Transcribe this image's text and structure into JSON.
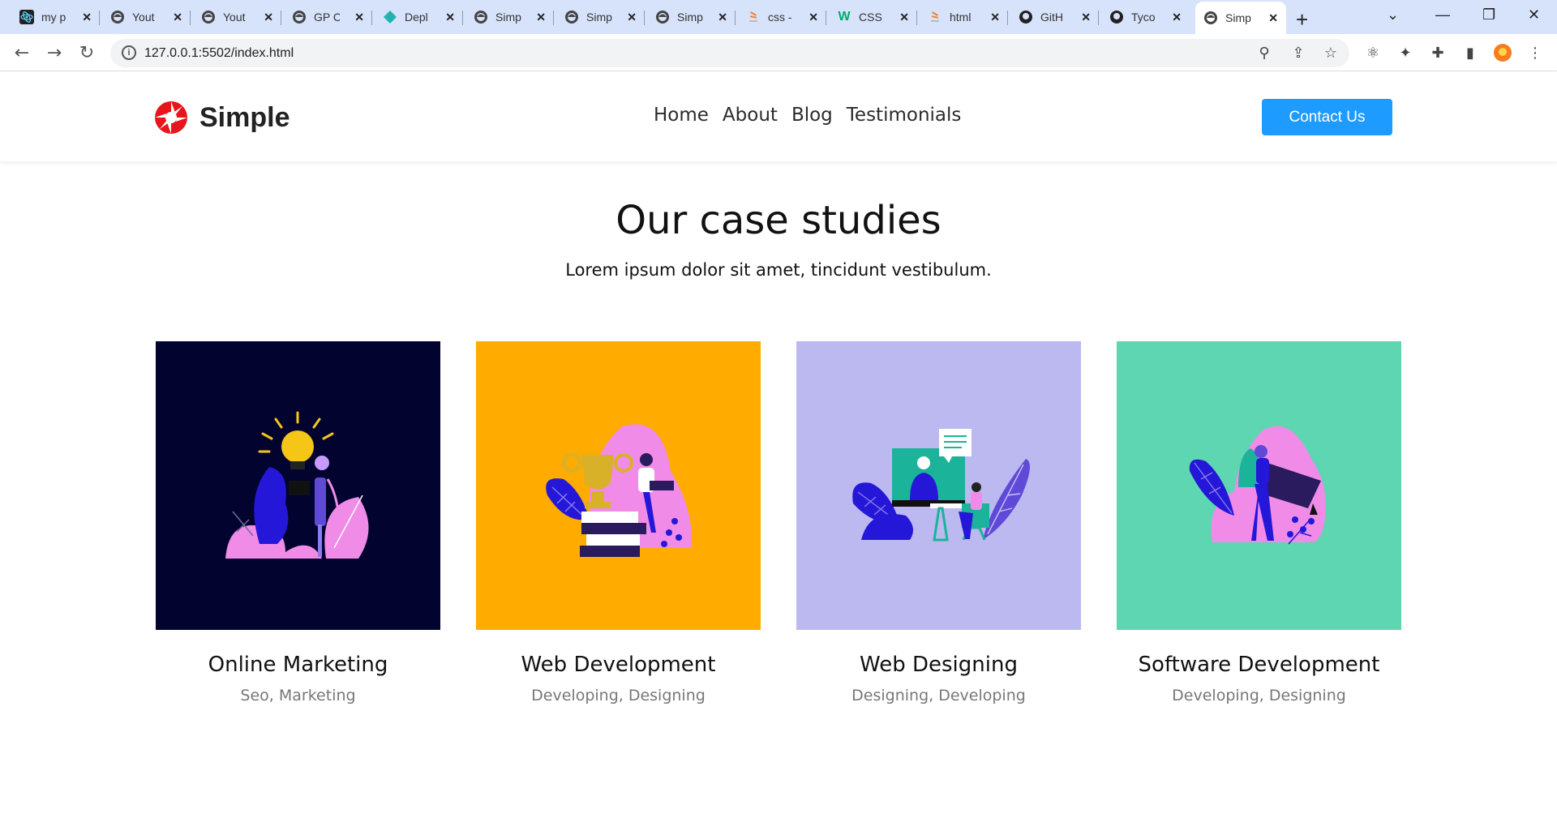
{
  "browser": {
    "tabs": [
      {
        "title": "my p",
        "icon": "react-icon"
      },
      {
        "title": "Yout",
        "icon": "globe-icon"
      },
      {
        "title": "Yout",
        "icon": "globe-icon"
      },
      {
        "title": "GP C",
        "icon": "globe-icon"
      },
      {
        "title": "Depl",
        "icon": "netlify-icon"
      },
      {
        "title": "Simp",
        "icon": "globe-icon"
      },
      {
        "title": "Simp",
        "icon": "globe-icon"
      },
      {
        "title": "Simp",
        "icon": "globe-icon"
      },
      {
        "title": "css -",
        "icon": "stackoverflow-icon"
      },
      {
        "title": "CSS",
        "icon": "w3schools-icon"
      },
      {
        "title": "html",
        "icon": "stackoverflow-icon"
      },
      {
        "title": "GitH",
        "icon": "github-icon"
      },
      {
        "title": "Tyco",
        "icon": "github-icon"
      },
      {
        "title": "Simp",
        "icon": "globe-icon",
        "active": true
      }
    ],
    "address": "127.0.0.1:5502/index.html"
  },
  "header": {
    "logo_text": "Simple",
    "nav": [
      "Home",
      "About",
      "Blog",
      "Testimonials"
    ],
    "cta_label": "Contact Us"
  },
  "section": {
    "title": "Our case studies",
    "subtitle": "Lorem ipsum dolor sit amet, tincidunt vestibulum."
  },
  "cards": [
    {
      "title": "Online Marketing",
      "tags": "Seo, Marketing",
      "bg": "#02042f",
      "illustration": "lightbulb-idea-illustration"
    },
    {
      "title": "Web Development",
      "tags": "Developing, Designing",
      "bg": "#ffab00",
      "illustration": "trophy-books-illustration"
    },
    {
      "title": "Web Designing",
      "tags": "Designing, Developing",
      "bg": "#bbb9ef",
      "illustration": "video-call-illustration"
    },
    {
      "title": "Software Development",
      "tags": "Developing, Designing",
      "bg": "#5ed6b1",
      "illustration": "graduation-cap-illustration"
    }
  ],
  "colors": {
    "brand_red": "#e8151b",
    "cta_blue": "#1e9bff",
    "tab_strip": "#d7e3fb"
  }
}
